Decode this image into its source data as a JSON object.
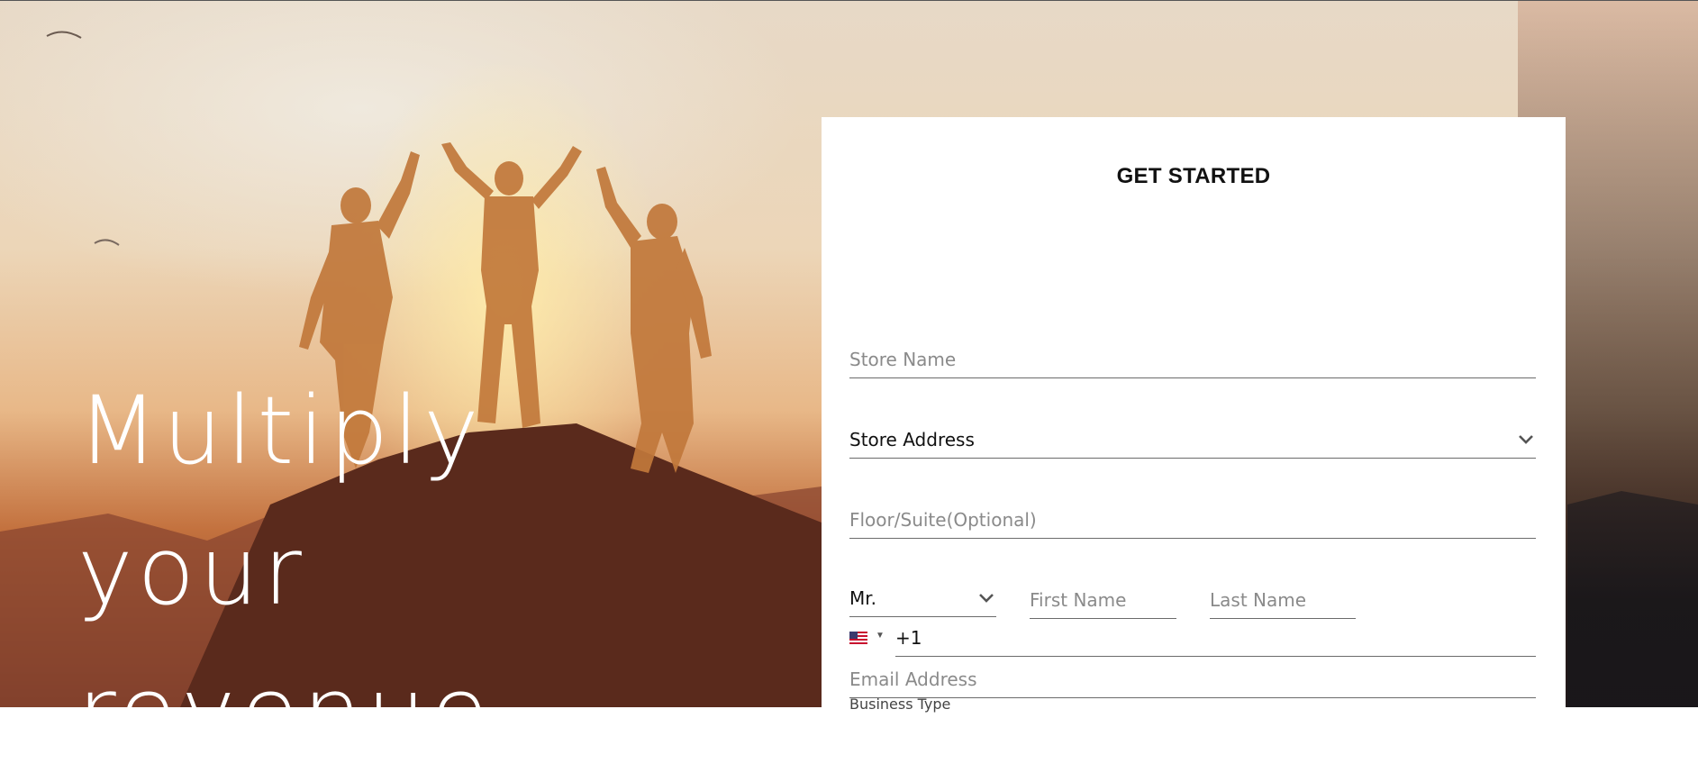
{
  "hero": {
    "headline_lines": [
      "Multiply",
      "your",
      "revenue"
    ]
  },
  "form": {
    "title": "GET STARTED",
    "store_name": {
      "placeholder": "Store Name",
      "value": ""
    },
    "store_address": {
      "selected": "Store Address"
    },
    "floor_suite": {
      "placeholder": "Floor/Suite(Optional)",
      "value": ""
    },
    "salutation": {
      "selected": "Mr."
    },
    "first_name": {
      "placeholder": "First Name",
      "value": ""
    },
    "last_name": {
      "placeholder": "Last Name",
      "value": ""
    },
    "email": {
      "placeholder": "Email Address",
      "value": ""
    },
    "phone": {
      "country_icon": "us-flag-icon",
      "code": "+1",
      "value": ""
    },
    "business_type_label": "Business Type"
  },
  "colors": {
    "card_bg": "#ffffff",
    "input_border": "#6b6b6b",
    "placeholder": "#8a8a8a",
    "headline": "#ffffff"
  }
}
